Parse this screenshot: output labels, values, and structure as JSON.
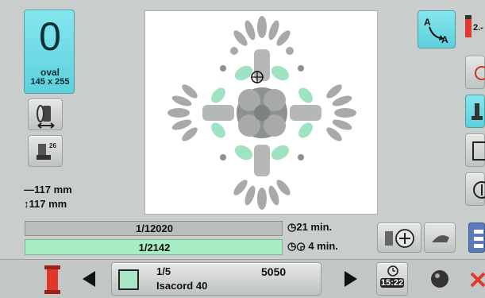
{
  "hoop": {
    "big_digit": "0",
    "name": "oval",
    "size": "145 x 255",
    "color": "#62d6e0"
  },
  "dimensions": {
    "width": "117 mm",
    "height": "117 mm"
  },
  "progress": {
    "stitch_counter": "1/12020",
    "color_counter": "1/2142",
    "color_fill_fraction": 0.98,
    "stitch_fill_fraction": 0.0
  },
  "time": {
    "total": "21 min.",
    "color": "4 min."
  },
  "bottom_bar": {
    "color_index": "1/5",
    "thread_name": "Isacord 40",
    "thread_code": "5050",
    "clock": "15:22",
    "swatch_color": "#a6e8c6"
  },
  "right_panel": {
    "tension_label": "2.-"
  },
  "colors": {
    "accent": "#62d6e0",
    "progress_green": "#a8ecc4",
    "design_gray": "#a7aaa9",
    "design_mint": "#9fe3c2",
    "design_dark": "#8e9192",
    "spool_red": "#e2362a",
    "stop_red": "#e0382a"
  },
  "icons": {
    "hoop_button": "hoop-icon",
    "presser_button": "presser-foot-icon",
    "move_button": "move-design-icon",
    "stitch_button": "stitch-icon",
    "thread_spool": "thread-spool-icon",
    "clock": "clock-icon",
    "cancel": "cancel-icon"
  }
}
